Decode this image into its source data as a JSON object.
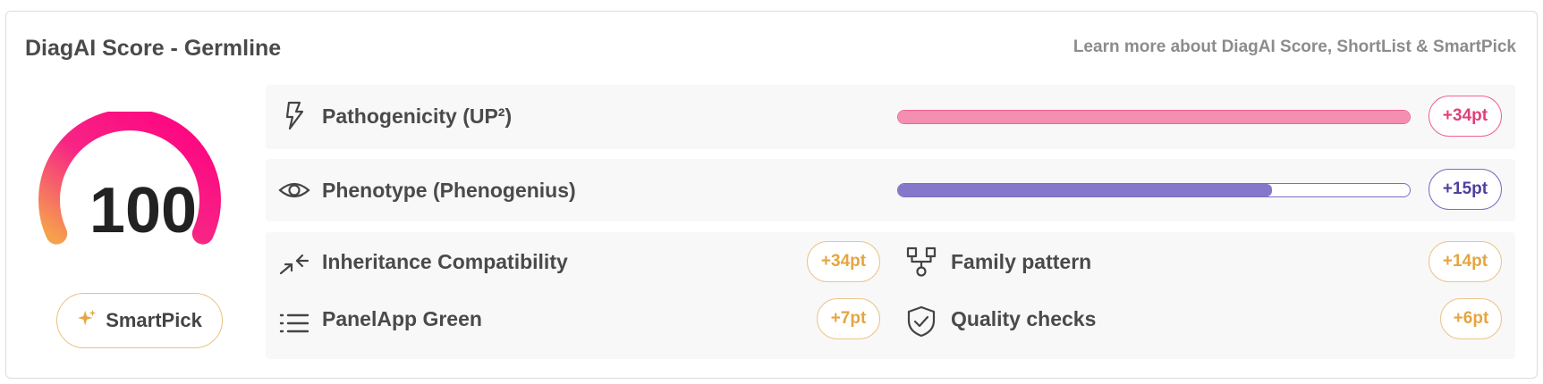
{
  "header": {
    "title": "DiagAI Score - Germline",
    "learn_more": "Learn more about DiagAI Score, ShortList & SmartPick"
  },
  "score": {
    "value": "100",
    "smartpick_label": "SmartPick",
    "gauge_colors": [
      "#f6a04d",
      "#f72585",
      "#ff0080"
    ]
  },
  "pathogenicity": {
    "label": "Pathogenicity (UP²)",
    "points": "+34pt",
    "bar_fraction": 1.0,
    "color": "#f06292",
    "icon": "lightning-icon"
  },
  "phenotype": {
    "label": "Phenotype (Phenogenius)",
    "points": "+15pt",
    "bar_fraction": 0.73,
    "color": "#7b6cc4",
    "icon": "eye-icon"
  },
  "criteria": [
    {
      "label": "Inheritance Compatibility",
      "points": "+34pt",
      "icon": "arrows-converge-icon"
    },
    {
      "label": "Family pattern",
      "points": "+14pt",
      "icon": "family-tree-icon"
    },
    {
      "label": "PanelApp Green",
      "points": "+7pt",
      "icon": "list-icon"
    },
    {
      "label": "Quality checks",
      "points": "+6pt",
      "icon": "shield-check-icon"
    }
  ],
  "accent_orange": "#e5a540"
}
